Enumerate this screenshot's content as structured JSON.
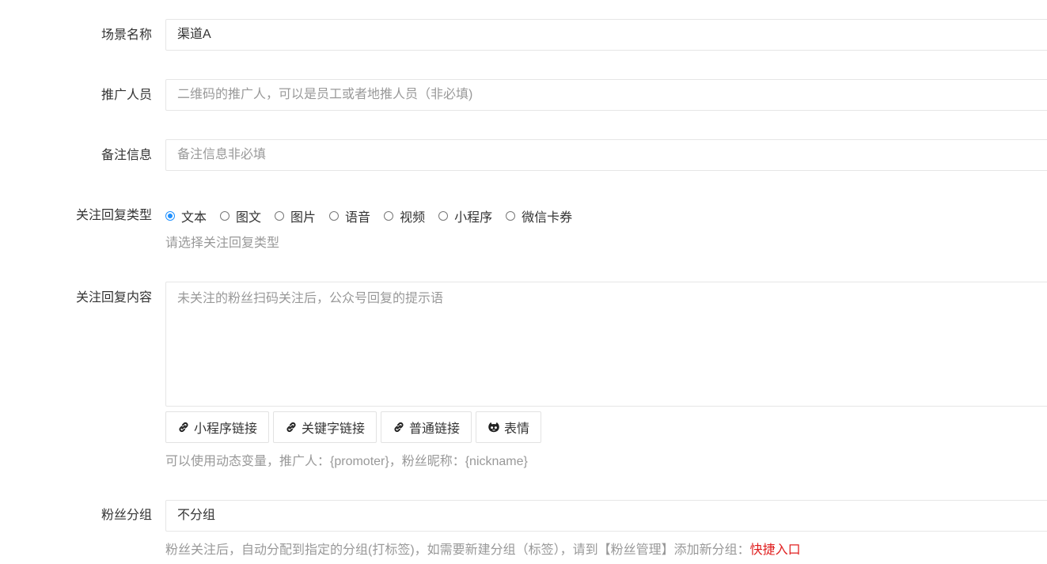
{
  "form": {
    "scene_name": {
      "label": "场景名称",
      "value": "渠道A"
    },
    "promoter": {
      "label": "推广人员",
      "placeholder": "二维码的推广人，可以是员工或者地推人员（非必填)"
    },
    "remark": {
      "label": "备注信息",
      "placeholder": "备注信息非必填"
    },
    "reply_type": {
      "label": "关注回复类型",
      "options": [
        "文本",
        "图文",
        "图片",
        "语音",
        "视频",
        "小程序",
        "微信卡券"
      ],
      "selected": "文本",
      "hint": "请选择关注回复类型"
    },
    "reply_content": {
      "label": "关注回复内容",
      "placeholder": "未关注的粉丝扫码关注后，公众号回复的提示语",
      "buttons": [
        "小程序链接",
        "关键字链接",
        "普通链接",
        "表情"
      ],
      "hint": "可以使用动态变量，推广人：{promoter}，粉丝昵称：{nickname}"
    },
    "fan_group": {
      "label": "粉丝分组",
      "value": "不分组",
      "hint": "粉丝关注后，自动分配到指定的分组(打标签)，如需要新建分组（标签），请到【粉丝管理】添加新分组：",
      "quick_link": "快捷入口"
    }
  },
  "colors": {
    "accent": "#1e90ff",
    "link_red": "#e02020",
    "hint_gray": "#999999",
    "border": "#e6e6e6"
  },
  "icons": {
    "link": "link-icon",
    "emoji": "emoji-icon"
  }
}
